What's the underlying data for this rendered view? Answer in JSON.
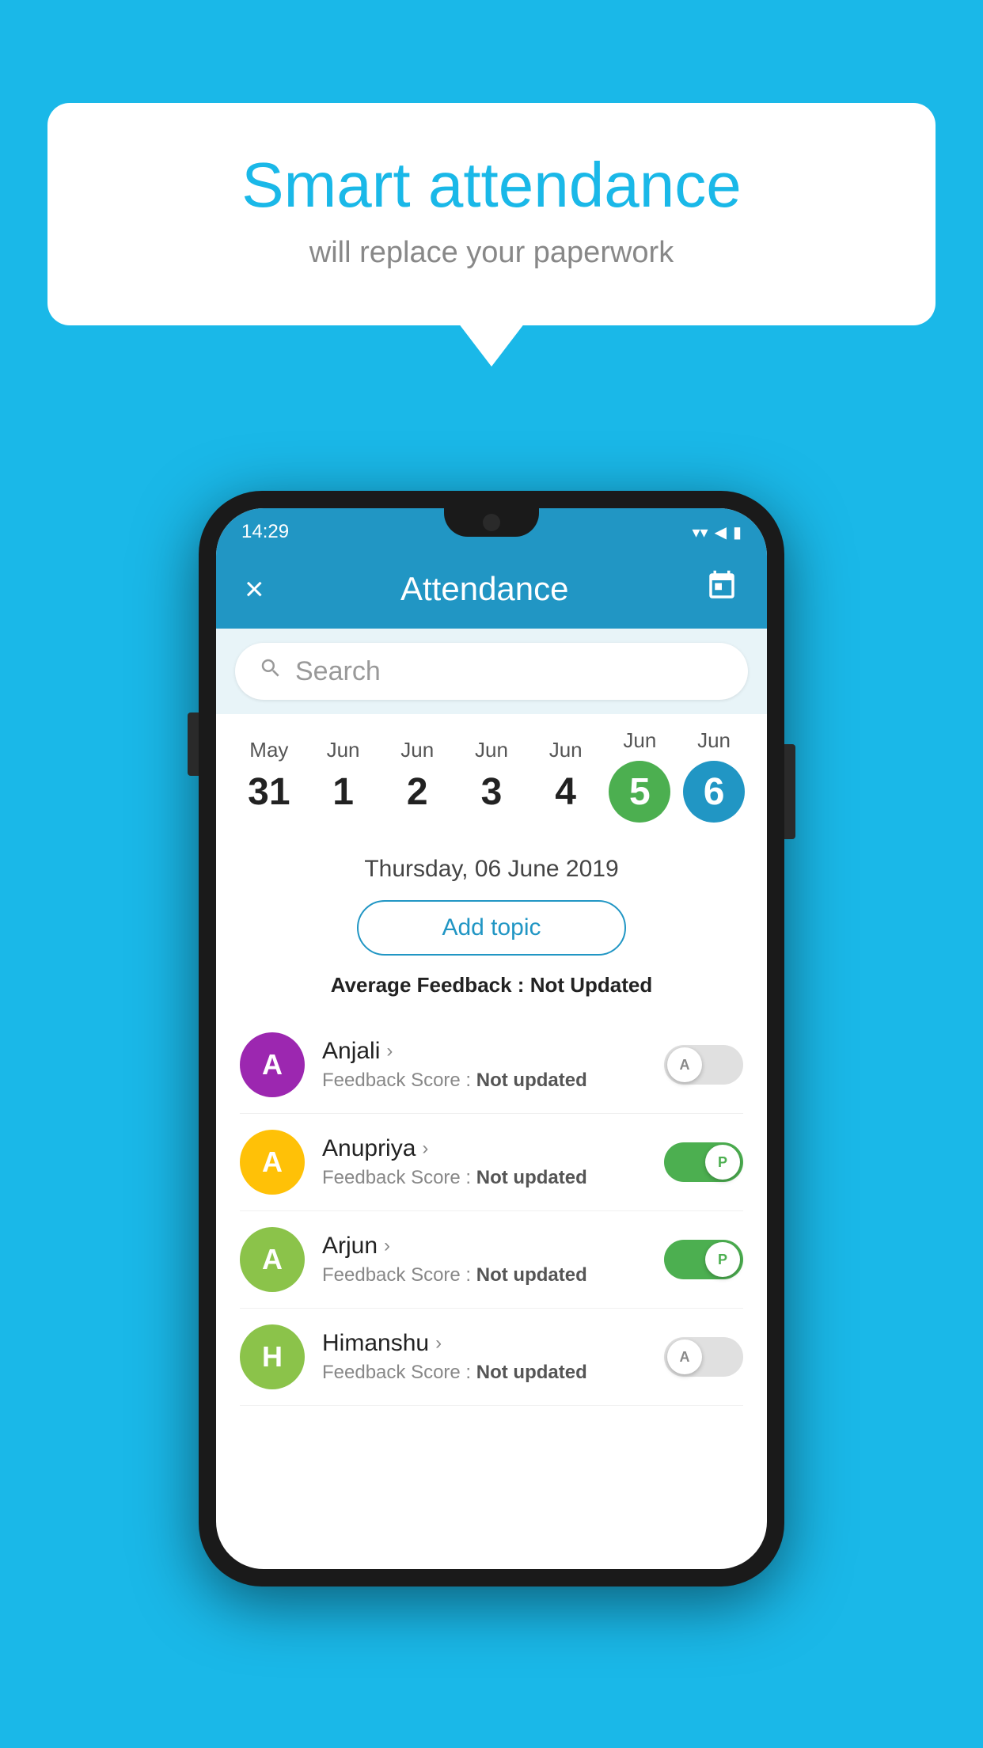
{
  "background_color": "#1ab8e8",
  "speech_bubble": {
    "title": "Smart attendance",
    "subtitle": "will replace your paperwork"
  },
  "status_bar": {
    "time": "14:29",
    "wifi": "▼",
    "signal": "▲",
    "battery": "▮"
  },
  "app_header": {
    "title": "Attendance",
    "close_label": "×",
    "calendar_icon": "📅"
  },
  "search": {
    "placeholder": "Search"
  },
  "calendar": {
    "days": [
      {
        "month": "May",
        "date": "31",
        "state": "normal"
      },
      {
        "month": "Jun",
        "date": "1",
        "state": "normal"
      },
      {
        "month": "Jun",
        "date": "2",
        "state": "normal"
      },
      {
        "month": "Jun",
        "date": "3",
        "state": "normal"
      },
      {
        "month": "Jun",
        "date": "4",
        "state": "normal"
      },
      {
        "month": "Jun",
        "date": "5",
        "state": "today"
      },
      {
        "month": "Jun",
        "date": "6",
        "state": "selected"
      }
    ]
  },
  "selected_date": "Thursday, 06 June 2019",
  "add_topic_label": "Add topic",
  "avg_feedback_label": "Average Feedback : ",
  "avg_feedback_value": "Not Updated",
  "students": [
    {
      "name": "Anjali",
      "initial": "A",
      "avatar_color": "#9c27b0",
      "feedback": "Not updated",
      "attendance": "absent"
    },
    {
      "name": "Anupriya",
      "initial": "A",
      "avatar_color": "#ffc107",
      "feedback": "Not updated",
      "attendance": "present"
    },
    {
      "name": "Arjun",
      "initial": "A",
      "avatar_color": "#8bc34a",
      "feedback": "Not updated",
      "attendance": "present"
    },
    {
      "name": "Himanshu",
      "initial": "H",
      "avatar_color": "#8bc34a",
      "feedback": "Not updated",
      "attendance": "absent"
    }
  ],
  "feedback_label": "Feedback Score : "
}
